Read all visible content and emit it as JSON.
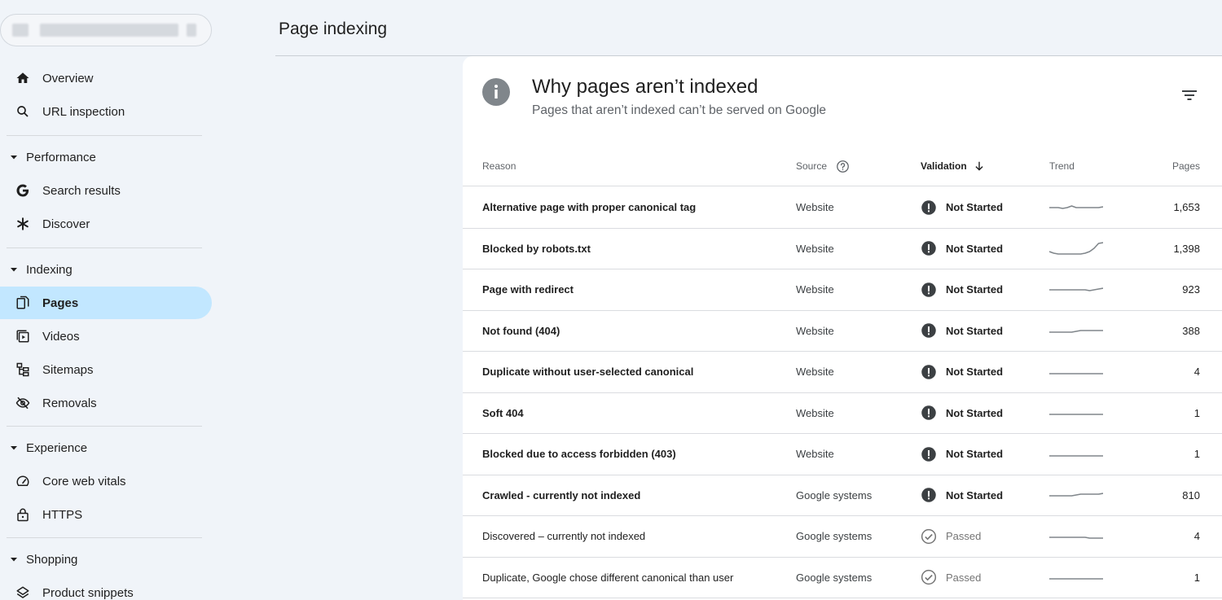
{
  "header": {
    "title": "Page indexing"
  },
  "sidebar": {
    "top_items": [
      {
        "label": "Overview",
        "icon": "home-icon"
      },
      {
        "label": "URL inspection",
        "icon": "search-icon"
      }
    ],
    "sections": [
      {
        "label": "Performance",
        "items": [
          {
            "label": "Search results",
            "icon": "google-g-icon"
          },
          {
            "label": "Discover",
            "icon": "asterisk-icon"
          }
        ]
      },
      {
        "label": "Indexing",
        "items": [
          {
            "label": "Pages",
            "icon": "pages-icon",
            "active": true
          },
          {
            "label": "Videos",
            "icon": "video-icon"
          },
          {
            "label": "Sitemaps",
            "icon": "sitemap-icon"
          },
          {
            "label": "Removals",
            "icon": "eye-off-icon"
          }
        ]
      },
      {
        "label": "Experience",
        "items": [
          {
            "label": "Core web vitals",
            "icon": "gauge-icon"
          },
          {
            "label": "HTTPS",
            "icon": "lock-icon"
          }
        ]
      },
      {
        "label": "Shopping",
        "items": [
          {
            "label": "Product snippets",
            "icon": "layers-icon"
          }
        ]
      }
    ]
  },
  "card": {
    "title": "Why pages aren’t indexed",
    "subtitle": "Pages that aren’t indexed can’t be served on Google"
  },
  "table": {
    "columns": {
      "reason": "Reason",
      "source": "Source",
      "validation": "Validation",
      "trend": "Trend",
      "pages": "Pages"
    },
    "rows": [
      {
        "reason": "Alternative page with proper canonical tag",
        "source": "Website",
        "validation": "Not Started",
        "status": "not-started",
        "pages": "1,653",
        "trend": [
          0.5,
          0.5,
          0.5,
          0.55,
          0.5,
          0.4,
          0.5,
          0.5,
          0.5,
          0.5,
          0.5,
          0.5,
          0.45
        ]
      },
      {
        "reason": "Blocked by robots.txt",
        "source": "Website",
        "validation": "Not Started",
        "status": "not-started",
        "pages": "1,398",
        "trend": [
          0.7,
          0.8,
          0.85,
          0.85,
          0.85,
          0.85,
          0.85,
          0.85,
          0.8,
          0.7,
          0.5,
          0.2,
          0.15
        ]
      },
      {
        "reason": "Page with redirect",
        "source": "Website",
        "validation": "Not Started",
        "status": "not-started",
        "pages": "923",
        "trend": [
          0.5,
          0.5,
          0.5,
          0.5,
          0.5,
          0.5,
          0.5,
          0.5,
          0.5,
          0.55,
          0.5,
          0.45,
          0.4
        ]
      },
      {
        "reason": "Not found (404)",
        "source": "Website",
        "validation": "Not Started",
        "status": "not-started",
        "pages": "388",
        "trend": [
          0.6,
          0.6,
          0.6,
          0.6,
          0.6,
          0.6,
          0.55,
          0.5,
          0.5,
          0.5,
          0.5,
          0.5,
          0.5
        ]
      },
      {
        "reason": "Duplicate without user-selected canonical",
        "source": "Website",
        "validation": "Not Started",
        "status": "not-started",
        "pages": "4",
        "trend": [
          0.6,
          0.6,
          0.6,
          0.6,
          0.6,
          0.6,
          0.6,
          0.6,
          0.6,
          0.6,
          0.6,
          0.6,
          0.6
        ]
      },
      {
        "reason": "Soft 404",
        "source": "Website",
        "validation": "Not Started",
        "status": "not-started",
        "pages": "1",
        "trend": [
          0.6,
          0.6,
          0.6,
          0.6,
          0.6,
          0.6,
          0.6,
          0.6,
          0.6,
          0.6,
          0.6,
          0.6,
          0.6
        ]
      },
      {
        "reason": "Blocked due to access forbidden (403)",
        "source": "Website",
        "validation": "Not Started",
        "status": "not-started",
        "pages": "1",
        "trend": [
          0.6,
          0.6,
          0.6,
          0.6,
          0.6,
          0.6,
          0.6,
          0.6,
          0.6,
          0.6,
          0.6,
          0.6,
          0.6
        ]
      },
      {
        "reason": "Crawled - currently not indexed",
        "source": "Google systems",
        "validation": "Not Started",
        "status": "not-started",
        "pages": "810",
        "trend": [
          0.55,
          0.55,
          0.55,
          0.55,
          0.55,
          0.55,
          0.5,
          0.45,
          0.45,
          0.45,
          0.45,
          0.45,
          0.4
        ]
      },
      {
        "reason": "Discovered – currently not indexed",
        "source": "Google systems",
        "validation": "Passed",
        "status": "passed",
        "pages": "4",
        "trend": [
          0.55,
          0.55,
          0.55,
          0.55,
          0.55,
          0.55,
          0.55,
          0.55,
          0.55,
          0.6,
          0.6,
          0.6,
          0.6
        ]
      },
      {
        "reason": "Duplicate, Google chose different canonical than user",
        "source": "Google systems",
        "validation": "Passed",
        "status": "passed",
        "pages": "1",
        "trend": [
          0.6,
          0.6,
          0.6,
          0.6,
          0.6,
          0.6,
          0.6,
          0.6,
          0.6,
          0.6,
          0.6,
          0.6,
          0.6
        ]
      }
    ]
  },
  "colors": {
    "active_nav": "#c2e7ff",
    "status_icon": "#3c4043",
    "passed_icon": "#757575"
  }
}
